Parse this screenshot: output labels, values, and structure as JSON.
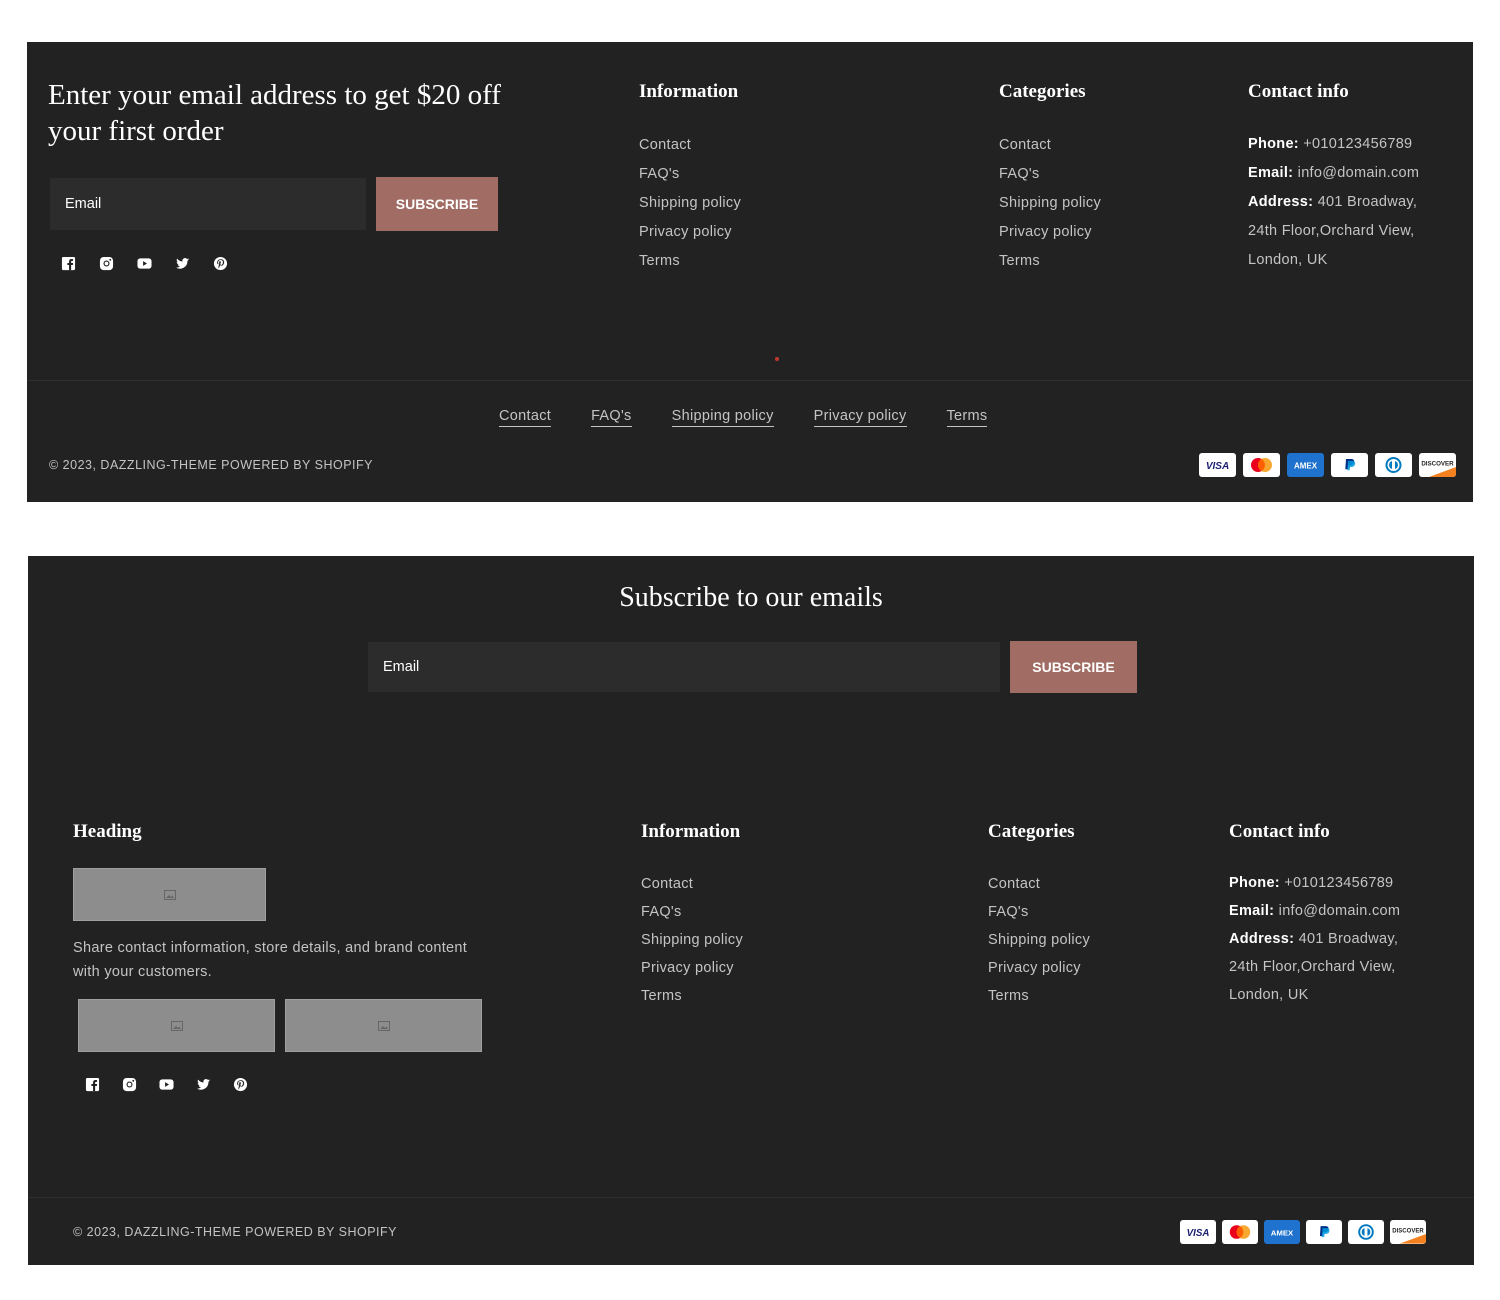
{
  "footer1": {
    "promo_heading": "Enter your email address to get $20 off your first order",
    "email_placeholder": "Email",
    "subscribe_label": "SUBSCRIBE",
    "information": {
      "heading": "Information",
      "links": [
        "Contact",
        "FAQ's",
        "Shipping policy",
        "Privacy policy",
        "Terms"
      ]
    },
    "categories": {
      "heading": "Categories",
      "links": [
        "Contact",
        "FAQ's",
        "Shipping policy",
        "Privacy policy",
        "Terms"
      ]
    },
    "contact": {
      "heading": "Contact info",
      "phone_label": "Phone:",
      "phone": "+010123456789",
      "email_label": "Email:",
      "email": "info@domain.com",
      "address_label": "Address:",
      "address_line1": "401 Broadway,",
      "address_line2": "24th Floor,Orchard View,",
      "address_line3": "London, UK"
    },
    "bottom_links": [
      "Contact",
      "FAQ's",
      "Shipping policy",
      "Privacy policy",
      "Terms"
    ],
    "copyright": "© 2023, DAZZLING-THEME POWERED BY SHOPIFY"
  },
  "footer2": {
    "subscribe_heading": "Subscribe to our emails",
    "email_placeholder": "Email",
    "subscribe_label": "SUBSCRIBE",
    "about": {
      "heading": "Heading",
      "text_line1": "Share contact information, store details, and brand content",
      "text_line2": "with your customers."
    },
    "information": {
      "heading": "Information",
      "links": [
        "Contact",
        "FAQ's",
        "Shipping policy",
        "Privacy policy",
        "Terms"
      ]
    },
    "categories": {
      "heading": "Categories",
      "links": [
        "Contact",
        "FAQ's",
        "Shipping policy",
        "Privacy policy",
        "Terms"
      ]
    },
    "contact": {
      "heading": "Contact info",
      "phone_label": "Phone:",
      "phone": "+010123456789",
      "email_label": "Email:",
      "email": "info@domain.com",
      "address_label": "Address:",
      "address_line1": "401 Broadway,",
      "address_line2": "24th Floor,Orchard View,",
      "address_line3": "London, UK"
    },
    "copyright": "© 2023, DAZZLING-THEME POWERED BY SHOPIFY"
  },
  "socials": [
    "facebook-icon",
    "instagram-icon",
    "youtube-icon",
    "twitter-icon",
    "pinterest-icon"
  ],
  "payments": {
    "visa": "VISA",
    "amex": "AMEX",
    "discover": "DISCOVER"
  },
  "colors": {
    "background": "#222222",
    "accent": "#a06c64",
    "input": "#2c2c2c",
    "placeholder_image": "#8d8d8d"
  }
}
